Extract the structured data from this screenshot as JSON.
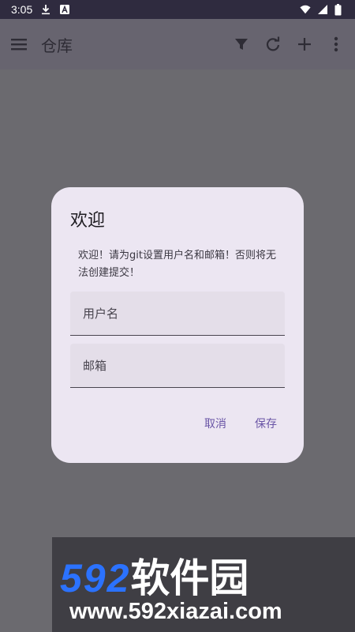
{
  "status_bar": {
    "time": "3:05",
    "icons": [
      "download-icon",
      "a-badge-icon",
      "wifi-icon",
      "signal-icon",
      "battery-icon"
    ]
  },
  "app_bar": {
    "title": "仓库",
    "actions": [
      "filter-icon",
      "refresh-icon",
      "add-icon",
      "more-vert-icon"
    ]
  },
  "dialog": {
    "title": "欢迎",
    "message": "欢迎！请为git设置用户名和邮箱！否则将无法创建提交！",
    "username_placeholder": "用户名",
    "email_placeholder": "邮箱",
    "cancel_label": "取消",
    "save_label": "保存"
  },
  "watermark": {
    "logo_number": "592",
    "logo_text": "软件园",
    "url": "www.592xiazai.com"
  },
  "colors": {
    "status_bar": "#2f2b3f",
    "app_bar": "#67646f",
    "scrim": "#6b6a6f",
    "dialog_surface": "#ece6f2",
    "accent": "#6a55a6",
    "watermark_blue": "#2b72ff"
  }
}
